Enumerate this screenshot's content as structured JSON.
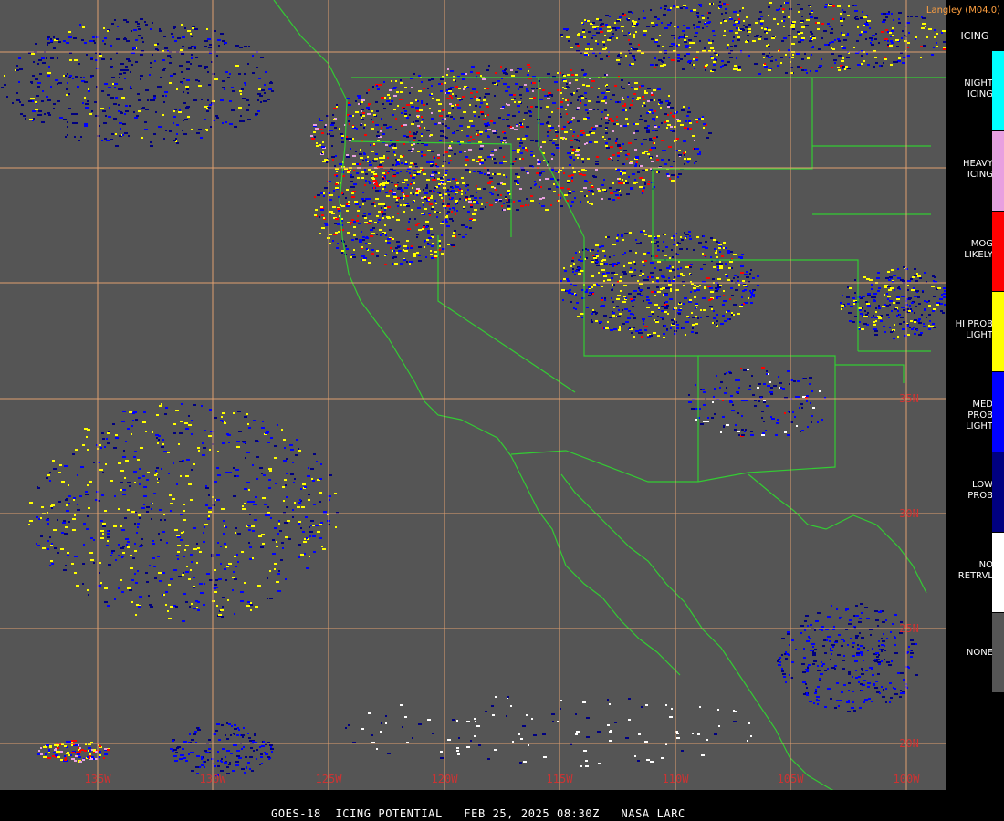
{
  "product": {
    "satellite": "GOES-18",
    "title": "ICING POTENTIAL",
    "date": "FEB 25, 2025 08:30Z",
    "agency": "NASA LARC"
  },
  "credit": "Langley (M04.0)",
  "legend": {
    "title": "ICING",
    "items": [
      {
        "line1": "NIGHT",
        "line2": "ICING",
        "color": "#00ffff"
      },
      {
        "line1": "HEAVY",
        "line2": "ICING",
        "color": "#e8a0e0"
      },
      {
        "line1": "MOG",
        "line2": "LIKELY",
        "color": "#ff0000"
      },
      {
        "line1": "HI PROB",
        "line2": "LIGHT",
        "color": "#ffff00"
      },
      {
        "line1": "MED PROB",
        "line2": "LIGHT",
        "color": "#0000ff"
      },
      {
        "line1": "LOW",
        "line2": "PROB",
        "color": "#000080"
      },
      {
        "line1": "NO",
        "line2": "RETRVL",
        "color": "#ffffff"
      },
      {
        "line1": "NONE",
        "line2": "",
        "color": "#555555"
      }
    ]
  },
  "longitude_labels": [
    "135W",
    "130W",
    "125W",
    "120W",
    "115W",
    "110W",
    "105W",
    "100W"
  ],
  "latitude_labels": [
    "35N",
    "30N",
    "25N",
    "20N"
  ],
  "colors": {
    "background": "#555555",
    "grid": "#e0a070",
    "coastline": "#33cc33",
    "axis_label": "#cc3333"
  }
}
